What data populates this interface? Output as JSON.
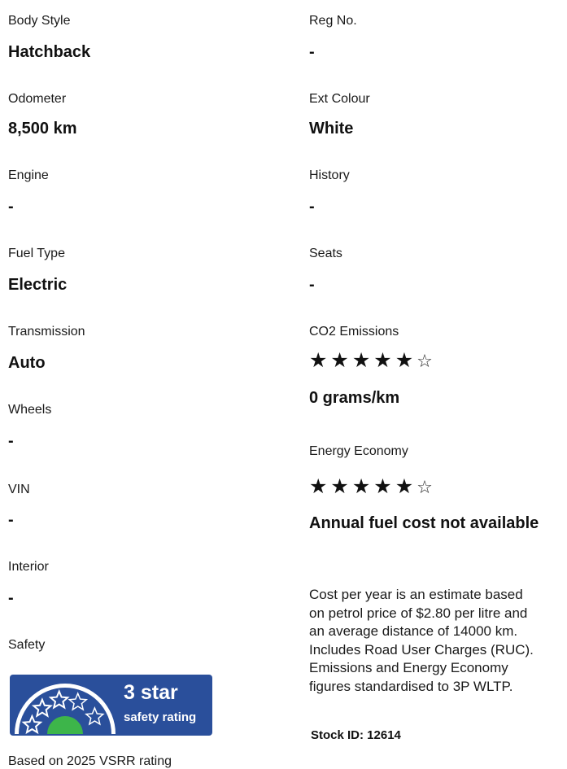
{
  "left": [
    {
      "label": "Body Style",
      "value": "Hatchback"
    },
    {
      "label": "Odometer",
      "value": "8,500 km"
    },
    {
      "label": "Engine",
      "value": "-"
    },
    {
      "label": "Fuel Type",
      "value": "Electric"
    },
    {
      "label": "Transmission",
      "value": "Auto"
    },
    {
      "label": "Wheels",
      "value": "-"
    },
    {
      "label": "VIN",
      "value": "-"
    },
    {
      "label": "Interior",
      "value": "-"
    }
  ],
  "safety": {
    "label": "Safety",
    "badge_title": "3 star",
    "badge_subtitle": "safety rating",
    "rating_stars": 3,
    "rating_max": 5,
    "basis": "Based on 2025 VSRR rating",
    "colors": {
      "badge_bg": "#2a4f9b",
      "star": "#2a4f9b",
      "dial": "#3db54a"
    }
  },
  "right": [
    {
      "label": "Reg No.",
      "value": "-"
    },
    {
      "label": "Ext Colour",
      "value": "White"
    },
    {
      "label": "History",
      "value": "-"
    },
    {
      "label": "Seats",
      "value": "-"
    }
  ],
  "co2": {
    "label": "CO2 Emissions",
    "rating": 5,
    "rating_max": 6,
    "value": "0 grams/km"
  },
  "energy": {
    "label": "Energy Economy",
    "rating": 5,
    "rating_max": 6,
    "value": "Annual fuel cost not available"
  },
  "note": "Cost per year is an estimate based\non petrol price of  $2.80 per litre and\nan average distance of 14000 km.\nIncludes Road User Charges (RUC).\nEmissions and Energy Economy\nfigures standardised to 3P WLTP.",
  "stock_id": "Stock ID: 12614"
}
